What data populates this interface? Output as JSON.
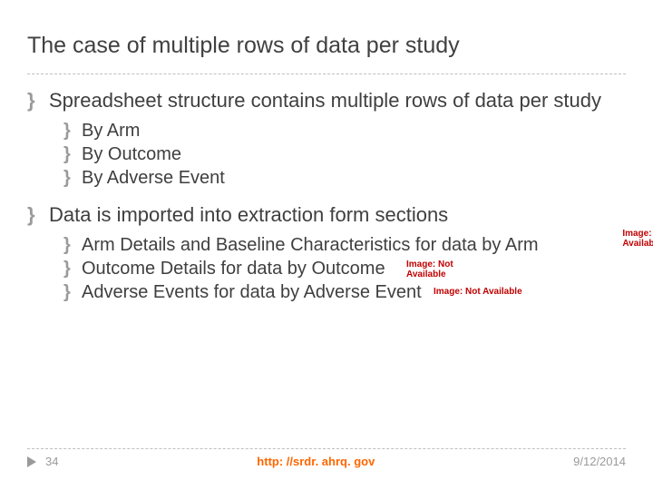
{
  "title": "The case of multiple rows of data per study",
  "bullet_char": "}",
  "section1": {
    "heading": "Spreadsheet structure contains multiple rows of data per study",
    "items": [
      "By Arm",
      "By Outcome",
      "By Adverse Event"
    ]
  },
  "section2": {
    "heading": "Data is imported into extraction form sections",
    "items": [
      "Arm Details and Baseline Characteristics for data by Arm",
      "Outcome Details for data by Outcome",
      "Adverse Events for data by Adverse Event"
    ]
  },
  "image_tag_prefix": "Image:",
  "image_tag_line2": "Not",
  "image_tag_line3": "Available",
  "footer": {
    "page": "34",
    "url": "http: //srdr. ahrq. gov",
    "date": "9/12/2014"
  }
}
